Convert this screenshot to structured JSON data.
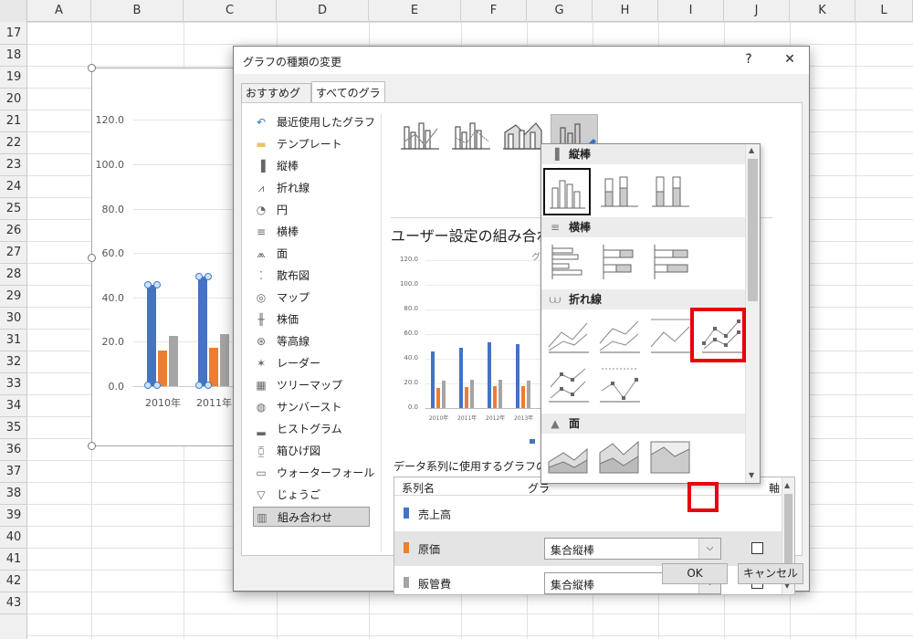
{
  "sheet": {
    "columns": [
      "A",
      "B",
      "C",
      "D",
      "E",
      "F",
      "G",
      "H",
      "I",
      "J",
      "K",
      "L"
    ],
    "rows": [
      "17",
      "18",
      "19",
      "20",
      "21",
      "22",
      "23",
      "24",
      "25",
      "26",
      "27",
      "28",
      "29",
      "30",
      "31",
      "32",
      "33",
      "34",
      "35",
      "36",
      "37",
      "38",
      "39",
      "40",
      "41",
      "42",
      "43"
    ],
    "chart": {
      "yticks": [
        "120.0",
        "100.0",
        "80.0",
        "60.0",
        "40.0",
        "20.0",
        "0.0"
      ],
      "xlabels": [
        "2010年",
        "2011年"
      ]
    }
  },
  "dialog": {
    "title": "グラフの種類の変更",
    "help_label": "?",
    "close_label": "✕",
    "tabs": [
      "おすすめグラフ",
      "すべてのグラフ"
    ],
    "active_tab": "すべてのグラフ",
    "categories": [
      {
        "icon": "recent-icon",
        "label": "最近使用したグラフ"
      },
      {
        "icon": "template-icon",
        "label": "テンプレート"
      },
      {
        "icon": "column-chart-icon",
        "label": "縦棒"
      },
      {
        "icon": "line-chart-icon",
        "label": "折れ線"
      },
      {
        "icon": "pie-chart-icon",
        "label": "円"
      },
      {
        "icon": "bar-chart-icon",
        "label": "横棒"
      },
      {
        "icon": "area-chart-icon",
        "label": "面"
      },
      {
        "icon": "scatter-chart-icon",
        "label": "散布図"
      },
      {
        "icon": "map-chart-icon",
        "label": "マップ"
      },
      {
        "icon": "stock-chart-icon",
        "label": "株価"
      },
      {
        "icon": "surface-chart-icon",
        "label": "等高線"
      },
      {
        "icon": "radar-chart-icon",
        "label": "レーダー"
      },
      {
        "icon": "treemap-chart-icon",
        "label": "ツリーマップ"
      },
      {
        "icon": "sunburst-chart-icon",
        "label": "サンバースト"
      },
      {
        "icon": "histogram-chart-icon",
        "label": "ヒストグラム"
      },
      {
        "icon": "boxwhisker-chart-icon",
        "label": "箱ひげ図"
      },
      {
        "icon": "waterfall-chart-icon",
        "label": "ウォーターフォール"
      },
      {
        "icon": "funnel-chart-icon",
        "label": "じょうご"
      },
      {
        "icon": "combo-chart-icon",
        "label": "組み合わせ"
      }
    ],
    "selected_category": "組み合わせ",
    "combo_heading": "ユーザー設定の組み合わ",
    "series_prompt": "データ系列に使用するグラフの種類",
    "table": {
      "col_name": "系列名",
      "col_type": "グラ",
      "col_axis": "軸",
      "rows": [
        {
          "name": "売上高",
          "color": "#4472c4",
          "type": ""
        },
        {
          "name": "原価",
          "color": "#ed7d31",
          "type": "集合縦棒"
        },
        {
          "name": "販管費",
          "color": "#a5a5a5",
          "type": "集合縦棒"
        }
      ]
    },
    "ok_label": "OK",
    "cancel_label": "キャンセル",
    "preview": {
      "yticks": [
        "120.0",
        "100.0",
        "80.0",
        "60.0",
        "40.0",
        "20.0",
        "0.0"
      ],
      "xlabels": [
        "2010年",
        "2011年",
        "2012年",
        "2013年",
        "20"
      ],
      "title_fragment": "グ"
    }
  },
  "gallery": {
    "sections": [
      {
        "icon": "column-chart-icon",
        "label": "縦棒"
      },
      {
        "icon": "bar-chart-icon",
        "label": "横棒"
      },
      {
        "icon": "line-chart-icon",
        "label": "折れ線"
      },
      {
        "icon": "area-chart-icon",
        "label": "面"
      }
    ]
  },
  "colors": {
    "series1": "#4472c4",
    "series2": "#ed7d31",
    "series3": "#a5a5a5",
    "highlight": "#e8000b"
  }
}
